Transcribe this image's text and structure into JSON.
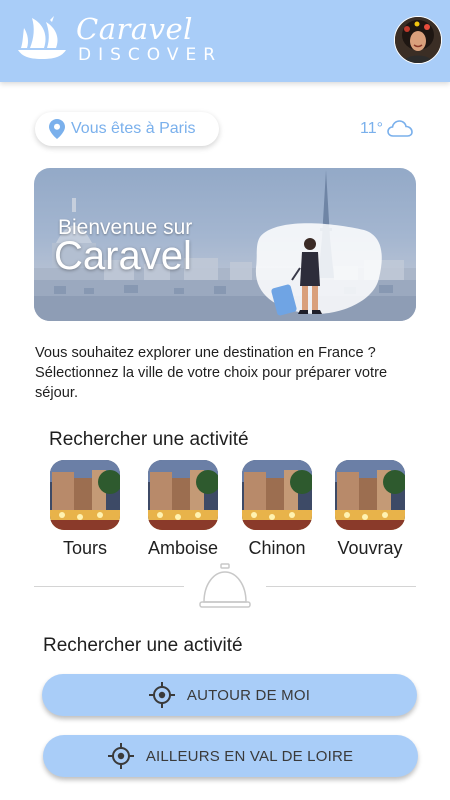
{
  "header": {
    "brand_script": "Caravel",
    "brand_sub": "DISCOVER",
    "bg_color": "#a9cdf8"
  },
  "location": {
    "label": "Vous êtes à Paris",
    "icon": "map-pin-icon"
  },
  "weather": {
    "temperature": "11°",
    "icon": "cloud-icon"
  },
  "hero": {
    "welcome": "Bienvenue sur",
    "title": "Caravel"
  },
  "intro_text": "Vous souhaitez explorer une destination en France ? Sélectionnez la ville de votre choix pour préparer votre séjour.",
  "activity_section": {
    "title": "Rechercher une activité",
    "cities": [
      "Tours",
      "Amboise",
      "Chinon",
      "Vouvray"
    ]
  },
  "search_section": {
    "title": "Rechercher une activité",
    "around_me_label": "AUTOUR DE MOI",
    "elsewhere_label": "AILLEURS EN VAL DE LOIRE",
    "icon": "crosshair-icon"
  },
  "accent_color": "#7ab0ec"
}
